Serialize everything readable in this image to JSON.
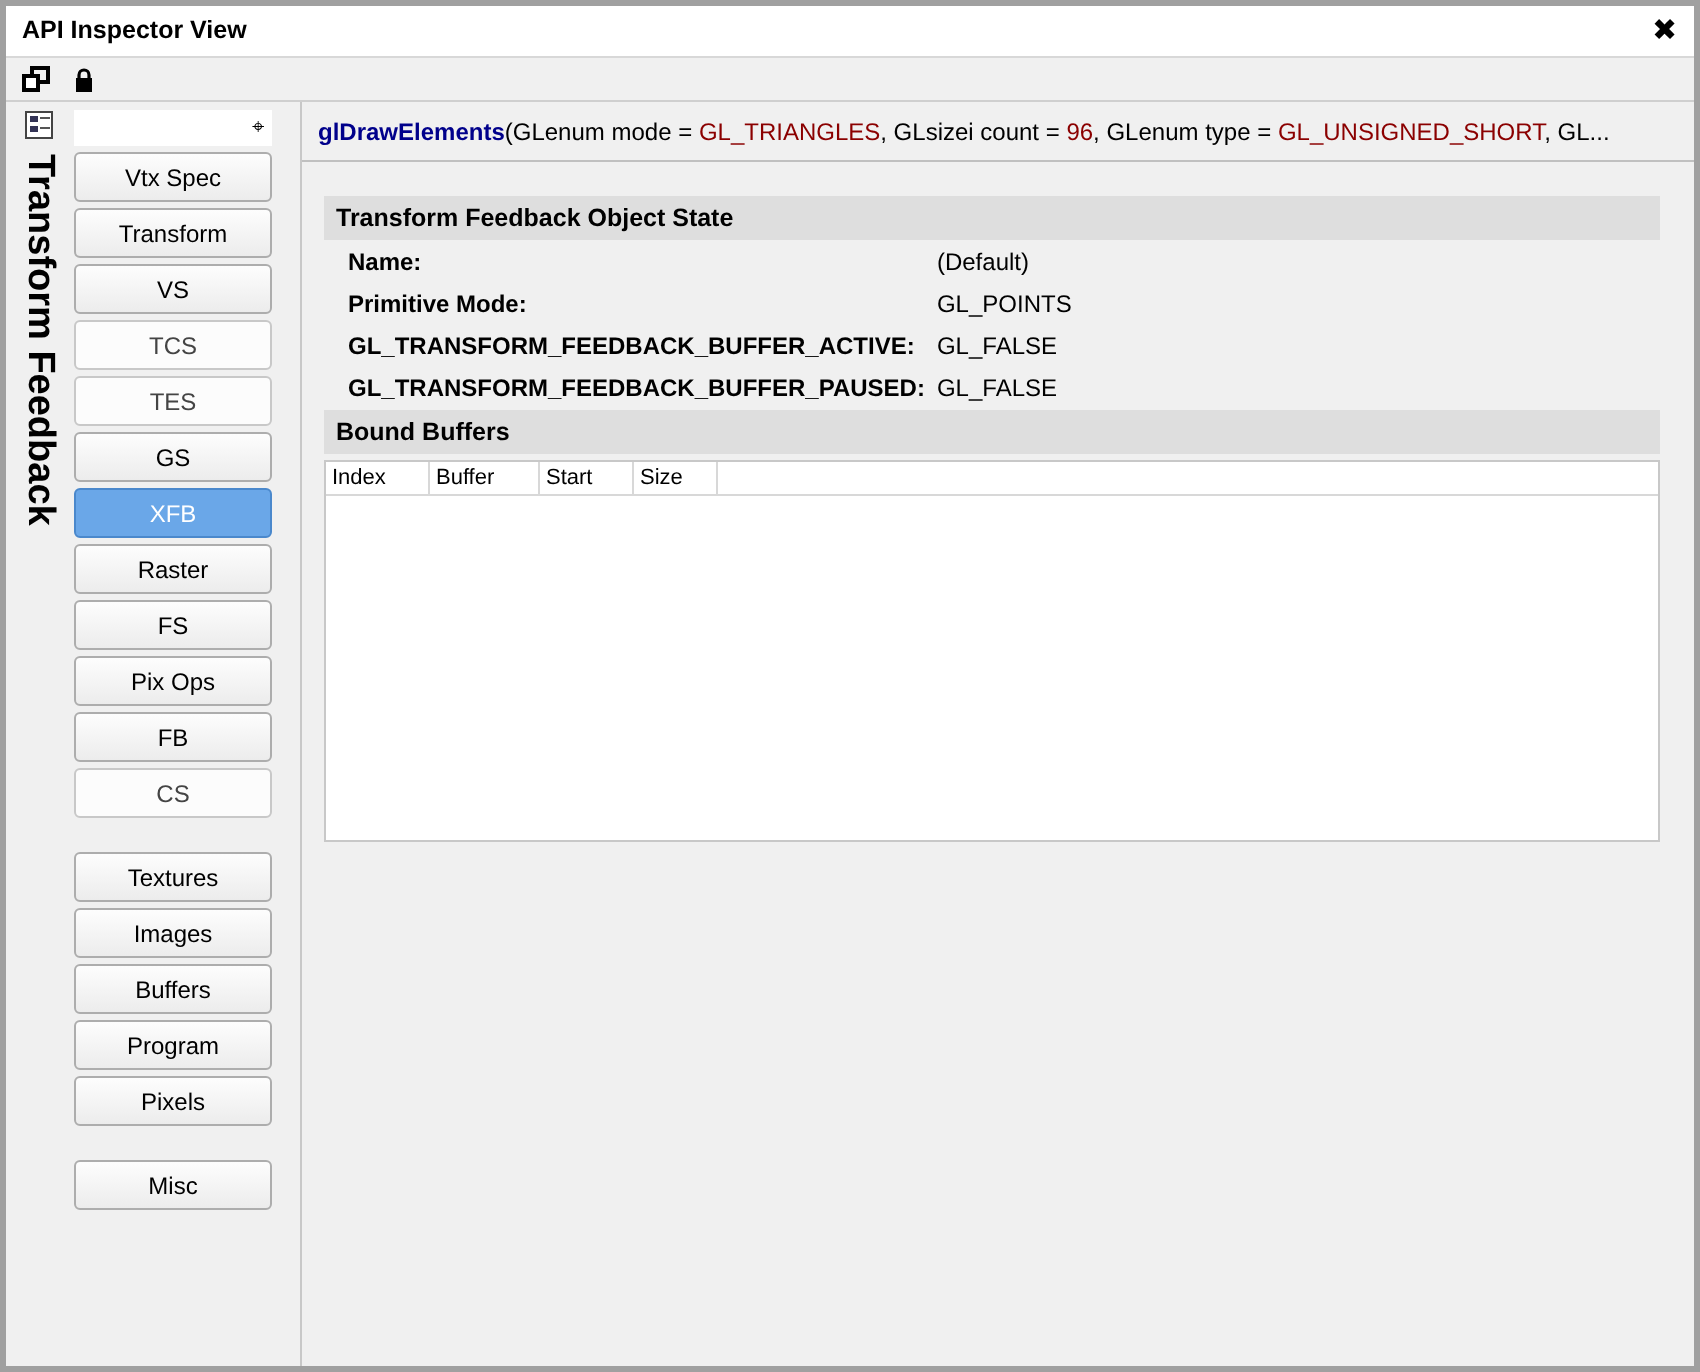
{
  "window": {
    "title": "API Inspector View",
    "close": "✖"
  },
  "sidebar": {
    "heading": "Transform Feedback",
    "filter": {
      "pin": "⌖"
    },
    "groups": [
      [
        {
          "label": "Vtx Spec",
          "selected": false,
          "disabled": false
        },
        {
          "label": "Transform",
          "selected": false,
          "disabled": false
        },
        {
          "label": "VS",
          "selected": false,
          "disabled": false
        },
        {
          "label": "TCS",
          "selected": false,
          "disabled": true
        },
        {
          "label": "TES",
          "selected": false,
          "disabled": true
        },
        {
          "label": "GS",
          "selected": false,
          "disabled": false
        },
        {
          "label": "XFB",
          "selected": true,
          "disabled": false
        },
        {
          "label": "Raster",
          "selected": false,
          "disabled": false
        },
        {
          "label": "FS",
          "selected": false,
          "disabled": false
        },
        {
          "label": "Pix Ops",
          "selected": false,
          "disabled": false
        },
        {
          "label": "FB",
          "selected": false,
          "disabled": false
        },
        {
          "label": "CS",
          "selected": false,
          "disabled": true
        }
      ],
      [
        {
          "label": "Textures",
          "selected": false,
          "disabled": false
        },
        {
          "label": "Images",
          "selected": false,
          "disabled": false
        },
        {
          "label": "Buffers",
          "selected": false,
          "disabled": false
        },
        {
          "label": "Program",
          "selected": false,
          "disabled": false
        },
        {
          "label": "Pixels",
          "selected": false,
          "disabled": false
        }
      ],
      [
        {
          "label": "Misc",
          "selected": false,
          "disabled": false
        }
      ]
    ]
  },
  "call": [
    {
      "kind": "function",
      "text": "glDrawElements"
    },
    {
      "kind": "plain",
      "text": "(GLenum mode = "
    },
    {
      "kind": "value",
      "text": "GL_TRIANGLES"
    },
    {
      "kind": "plain",
      "text": ", GLsizei count = "
    },
    {
      "kind": "value",
      "text": "96"
    },
    {
      "kind": "plain",
      "text": ", GLenum type = "
    },
    {
      "kind": "value",
      "text": "GL_UNSIGNED_SHORT"
    },
    {
      "kind": "plain",
      "text": ", GL..."
    }
  ],
  "object_state": {
    "title": "Transform Feedback Object State",
    "rows": [
      {
        "label": "Name:",
        "value": "(Default)"
      },
      {
        "label": "Primitive Mode:",
        "value": "GL_POINTS"
      },
      {
        "label": "GL_TRANSFORM_FEEDBACK_BUFFER_ACTIVE:",
        "value": "GL_FALSE"
      },
      {
        "label": "GL_TRANSFORM_FEEDBACK_BUFFER_PAUSED:",
        "value": "GL_FALSE"
      }
    ]
  },
  "bound_buffers": {
    "title": "Bound Buffers",
    "columns": [
      "Index",
      "Buffer",
      "Start",
      "Size"
    ]
  }
}
